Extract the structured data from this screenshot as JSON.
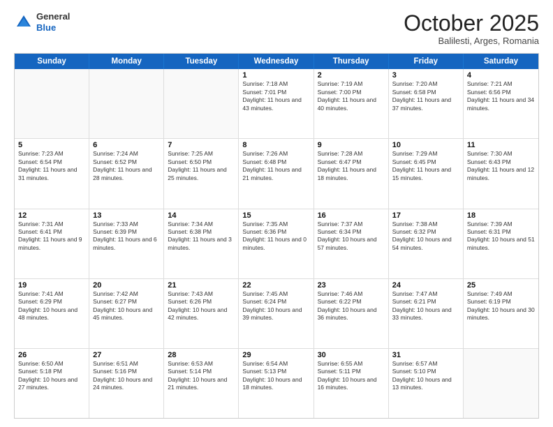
{
  "header": {
    "logo_general": "General",
    "logo_blue": "Blue",
    "month": "October 2025",
    "location": "Balilesti, Arges, Romania"
  },
  "days_of_week": [
    "Sunday",
    "Monday",
    "Tuesday",
    "Wednesday",
    "Thursday",
    "Friday",
    "Saturday"
  ],
  "rows": [
    [
      {
        "day": "",
        "text": "",
        "empty": true
      },
      {
        "day": "",
        "text": "",
        "empty": true
      },
      {
        "day": "",
        "text": "",
        "empty": true
      },
      {
        "day": "1",
        "text": "Sunrise: 7:18 AM\nSunset: 7:01 PM\nDaylight: 11 hours and 43 minutes.",
        "empty": false
      },
      {
        "day": "2",
        "text": "Sunrise: 7:19 AM\nSunset: 7:00 PM\nDaylight: 11 hours and 40 minutes.",
        "empty": false
      },
      {
        "day": "3",
        "text": "Sunrise: 7:20 AM\nSunset: 6:58 PM\nDaylight: 11 hours and 37 minutes.",
        "empty": false
      },
      {
        "day": "4",
        "text": "Sunrise: 7:21 AM\nSunset: 6:56 PM\nDaylight: 11 hours and 34 minutes.",
        "empty": false
      }
    ],
    [
      {
        "day": "5",
        "text": "Sunrise: 7:23 AM\nSunset: 6:54 PM\nDaylight: 11 hours and 31 minutes.",
        "empty": false
      },
      {
        "day": "6",
        "text": "Sunrise: 7:24 AM\nSunset: 6:52 PM\nDaylight: 11 hours and 28 minutes.",
        "empty": false
      },
      {
        "day": "7",
        "text": "Sunrise: 7:25 AM\nSunset: 6:50 PM\nDaylight: 11 hours and 25 minutes.",
        "empty": false
      },
      {
        "day": "8",
        "text": "Sunrise: 7:26 AM\nSunset: 6:48 PM\nDaylight: 11 hours and 21 minutes.",
        "empty": false
      },
      {
        "day": "9",
        "text": "Sunrise: 7:28 AM\nSunset: 6:47 PM\nDaylight: 11 hours and 18 minutes.",
        "empty": false
      },
      {
        "day": "10",
        "text": "Sunrise: 7:29 AM\nSunset: 6:45 PM\nDaylight: 11 hours and 15 minutes.",
        "empty": false
      },
      {
        "day": "11",
        "text": "Sunrise: 7:30 AM\nSunset: 6:43 PM\nDaylight: 11 hours and 12 minutes.",
        "empty": false
      }
    ],
    [
      {
        "day": "12",
        "text": "Sunrise: 7:31 AM\nSunset: 6:41 PM\nDaylight: 11 hours and 9 minutes.",
        "empty": false
      },
      {
        "day": "13",
        "text": "Sunrise: 7:33 AM\nSunset: 6:39 PM\nDaylight: 11 hours and 6 minutes.",
        "empty": false
      },
      {
        "day": "14",
        "text": "Sunrise: 7:34 AM\nSunset: 6:38 PM\nDaylight: 11 hours and 3 minutes.",
        "empty": false
      },
      {
        "day": "15",
        "text": "Sunrise: 7:35 AM\nSunset: 6:36 PM\nDaylight: 11 hours and 0 minutes.",
        "empty": false
      },
      {
        "day": "16",
        "text": "Sunrise: 7:37 AM\nSunset: 6:34 PM\nDaylight: 10 hours and 57 minutes.",
        "empty": false
      },
      {
        "day": "17",
        "text": "Sunrise: 7:38 AM\nSunset: 6:32 PM\nDaylight: 10 hours and 54 minutes.",
        "empty": false
      },
      {
        "day": "18",
        "text": "Sunrise: 7:39 AM\nSunset: 6:31 PM\nDaylight: 10 hours and 51 minutes.",
        "empty": false
      }
    ],
    [
      {
        "day": "19",
        "text": "Sunrise: 7:41 AM\nSunset: 6:29 PM\nDaylight: 10 hours and 48 minutes.",
        "empty": false
      },
      {
        "day": "20",
        "text": "Sunrise: 7:42 AM\nSunset: 6:27 PM\nDaylight: 10 hours and 45 minutes.",
        "empty": false
      },
      {
        "day": "21",
        "text": "Sunrise: 7:43 AM\nSunset: 6:26 PM\nDaylight: 10 hours and 42 minutes.",
        "empty": false
      },
      {
        "day": "22",
        "text": "Sunrise: 7:45 AM\nSunset: 6:24 PM\nDaylight: 10 hours and 39 minutes.",
        "empty": false
      },
      {
        "day": "23",
        "text": "Sunrise: 7:46 AM\nSunset: 6:22 PM\nDaylight: 10 hours and 36 minutes.",
        "empty": false
      },
      {
        "day": "24",
        "text": "Sunrise: 7:47 AM\nSunset: 6:21 PM\nDaylight: 10 hours and 33 minutes.",
        "empty": false
      },
      {
        "day": "25",
        "text": "Sunrise: 7:49 AM\nSunset: 6:19 PM\nDaylight: 10 hours and 30 minutes.",
        "empty": false
      }
    ],
    [
      {
        "day": "26",
        "text": "Sunrise: 6:50 AM\nSunset: 5:18 PM\nDaylight: 10 hours and 27 minutes.",
        "empty": false
      },
      {
        "day": "27",
        "text": "Sunrise: 6:51 AM\nSunset: 5:16 PM\nDaylight: 10 hours and 24 minutes.",
        "empty": false
      },
      {
        "day": "28",
        "text": "Sunrise: 6:53 AM\nSunset: 5:14 PM\nDaylight: 10 hours and 21 minutes.",
        "empty": false
      },
      {
        "day": "29",
        "text": "Sunrise: 6:54 AM\nSunset: 5:13 PM\nDaylight: 10 hours and 18 minutes.",
        "empty": false
      },
      {
        "day": "30",
        "text": "Sunrise: 6:55 AM\nSunset: 5:11 PM\nDaylight: 10 hours and 16 minutes.",
        "empty": false
      },
      {
        "day": "31",
        "text": "Sunrise: 6:57 AM\nSunset: 5:10 PM\nDaylight: 10 hours and 13 minutes.",
        "empty": false
      },
      {
        "day": "",
        "text": "",
        "empty": true
      }
    ]
  ]
}
